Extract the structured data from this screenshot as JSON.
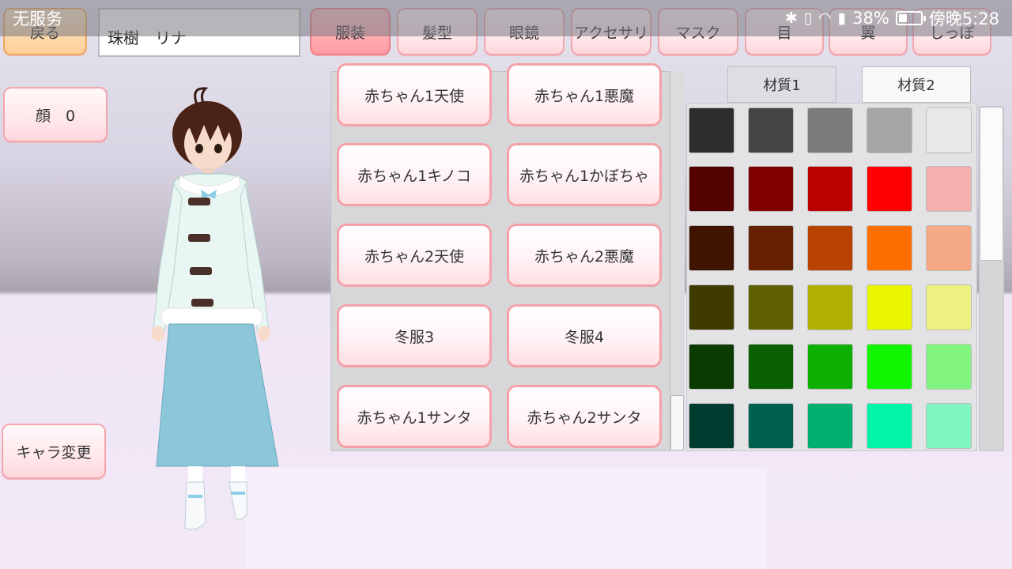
{
  "status_bar": {
    "carrier": "无服务",
    "battery": "38%",
    "battery_level": 0.38,
    "time": "傍晚5:28",
    "icons": [
      "bluetooth-icon",
      "vibrate-icon",
      "wifi-icon",
      "sim-icon",
      "battery-icon"
    ]
  },
  "top_bar": {
    "back_label": "戻る",
    "character_name": "珠樹　リナ",
    "tabs": [
      {
        "label": "服装",
        "active": true
      },
      {
        "label": "髪型",
        "active": false
      },
      {
        "label": "眼鏡",
        "active": false
      },
      {
        "label": "アクセサリ",
        "active": false
      },
      {
        "label": "マスク",
        "active": false
      },
      {
        "label": "目",
        "active": false
      },
      {
        "label": "翼",
        "active": false
      },
      {
        "label": "しっぽ",
        "active": false
      }
    ]
  },
  "left_panel": {
    "face_label": "顔　0",
    "change_character_label": "キャラ変更"
  },
  "outfit_list": {
    "items": [
      "赤ちゃん1天使",
      "赤ちゃん1悪魔",
      "赤ちゃん1キノコ",
      "赤ちゃん1かぼちゃ",
      "赤ちゃん2天使",
      "赤ちゃん2悪魔",
      "冬服3",
      "冬服4",
      "赤ちゃん1サンタ",
      "赤ちゃん2サンタ"
    ]
  },
  "material_tabs": {
    "tab1": "材質1",
    "tab2": "材質2"
  },
  "palette": {
    "rows": [
      [
        "#2e2e2e",
        "#444444",
        "#7b7b7b",
        "#a6a6a6",
        "#e8e8e8"
      ],
      [
        "#520000",
        "#800000",
        "#bb0000",
        "#ff0000",
        "#f5b0b0"
      ],
      [
        "#3e1400",
        "#662200",
        "#b84200",
        "#ff6e00",
        "#f5aa85"
      ],
      [
        "#3e3a00",
        "#606000",
        "#b0b000",
        "#eaf500",
        "#eef280"
      ],
      [
        "#0b3b00",
        "#0a6000",
        "#0db000",
        "#10f500",
        "#82f580"
      ],
      [
        "#003b30",
        "#006050",
        "#00b070",
        "#00f5a8",
        "#80f5c0"
      ]
    ]
  }
}
